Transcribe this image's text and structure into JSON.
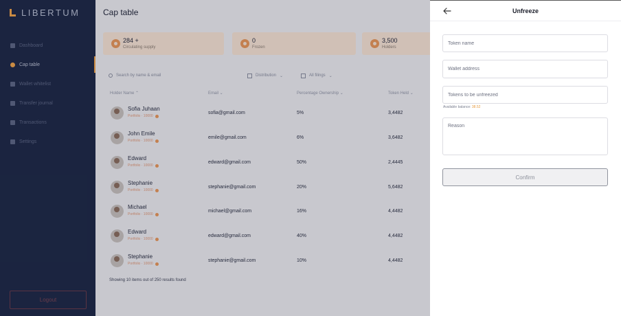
{
  "brand": {
    "name": "LIBERTUM",
    "accent": "#f2a54a"
  },
  "sidebar": {
    "items": [
      {
        "label": "Dashboard",
        "icon": "dashboard-icon"
      },
      {
        "label": "Cap table",
        "icon": "pie-chart-icon",
        "active": true
      },
      {
        "label": "Wallet whitelist",
        "icon": "wallet-icon"
      },
      {
        "label": "Transfer journal",
        "icon": "journal-icon"
      },
      {
        "label": "Transactions",
        "icon": "transactions-icon"
      },
      {
        "label": "Settings",
        "icon": "gear-icon"
      }
    ],
    "logout_label": "Logout"
  },
  "main": {
    "title": "Cap table",
    "stats": [
      {
        "value": "284 +",
        "label": "Circulating supply"
      },
      {
        "value": "0",
        "label": "Frozen"
      },
      {
        "value": "3,500",
        "label": "Holders"
      }
    ],
    "search_placeholder": "Search by name & email",
    "filters": [
      "Distribution",
      "All filings"
    ],
    "columns": [
      "Holder Name",
      "Email",
      "Percentage Ownership",
      "Token Held"
    ],
    "rows": [
      {
        "name": "Sofia Juhaan",
        "sub": "Portfolio · 10000",
        "email": "sofia@gmail.com",
        "pct": "5%",
        "tokens": "3,4482"
      },
      {
        "name": "John Emile",
        "sub": "Portfolio · 10000",
        "email": "emile@gmail.com",
        "pct": "6%",
        "tokens": "3,6482"
      },
      {
        "name": "Edward",
        "sub": "Portfolio · 10000",
        "email": "edward@gmail.com",
        "pct": "50%",
        "tokens": "2,4445"
      },
      {
        "name": "Stephanie",
        "sub": "Portfolio · 10000",
        "email": "stephanie@gmail.com",
        "pct": "20%",
        "tokens": "5,6482"
      },
      {
        "name": "Michael",
        "sub": "Portfolio · 10000",
        "email": "michael@gmail.com",
        "pct": "16%",
        "tokens": "4,4482"
      },
      {
        "name": "Edward",
        "sub": "Portfolio · 10000",
        "email": "edward@gmail.com",
        "pct": "40%",
        "tokens": "4,4482"
      },
      {
        "name": "Stephanie",
        "sub": "Portfolio · 10000",
        "email": "stephanie@gmail.com",
        "pct": "10%",
        "tokens": "4,4482"
      }
    ],
    "footer": "Showing 10 items out of 250 results found"
  },
  "panel": {
    "title": "Unfreeze",
    "token_name_placeholder": "Token name",
    "wallet_placeholder": "Wallet address",
    "tokens_placeholder": "Tokens to be unfreezed",
    "balance_label": "Available balance: ",
    "balance_value": "38.52",
    "reason_placeholder": "Reason",
    "confirm_label": "Confirm"
  }
}
